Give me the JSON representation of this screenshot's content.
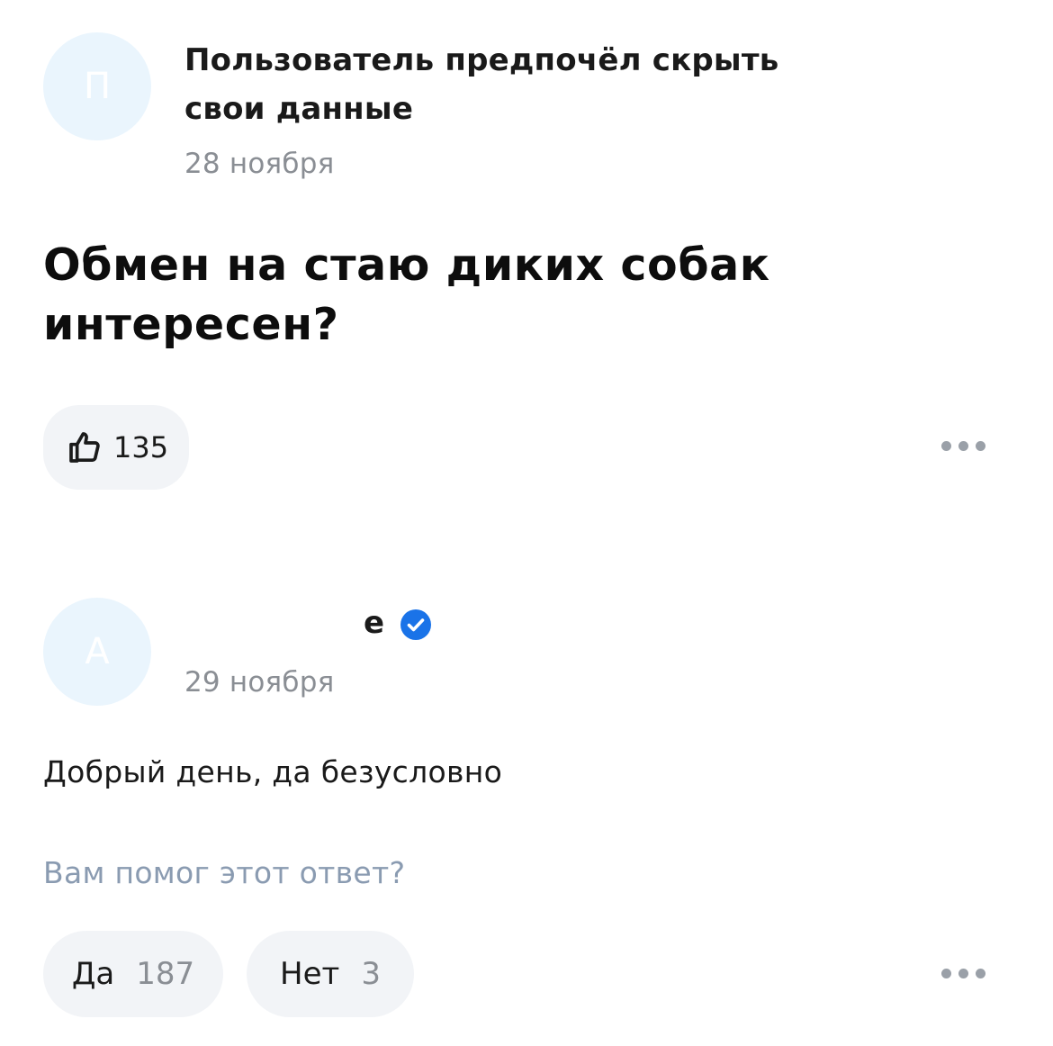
{
  "question_post": {
    "author": {
      "avatar_letter": "П",
      "name": "Пользователь предпочёл скрыть свои данные",
      "date": "28 ноября"
    },
    "title": "Обмен на стаю диких собак интересен?",
    "likes": {
      "icon": "thumbs-up-icon",
      "count": "135"
    },
    "more_icon": "more-dots-icon"
  },
  "answer": {
    "author": {
      "avatar_letter": "А",
      "name_visible_fragment": "е",
      "verified_icon": "verified-check-icon",
      "verified_color": "#1a73e8",
      "date": "29 ноября"
    },
    "text": "Добрый день, да безусловно",
    "helpful_question": "Вам помог этот ответ?",
    "votes": {
      "yes_label": "Да",
      "yes_count": "187",
      "no_label": "Нет",
      "no_count": "3"
    },
    "more_icon": "more-dots-icon"
  }
}
